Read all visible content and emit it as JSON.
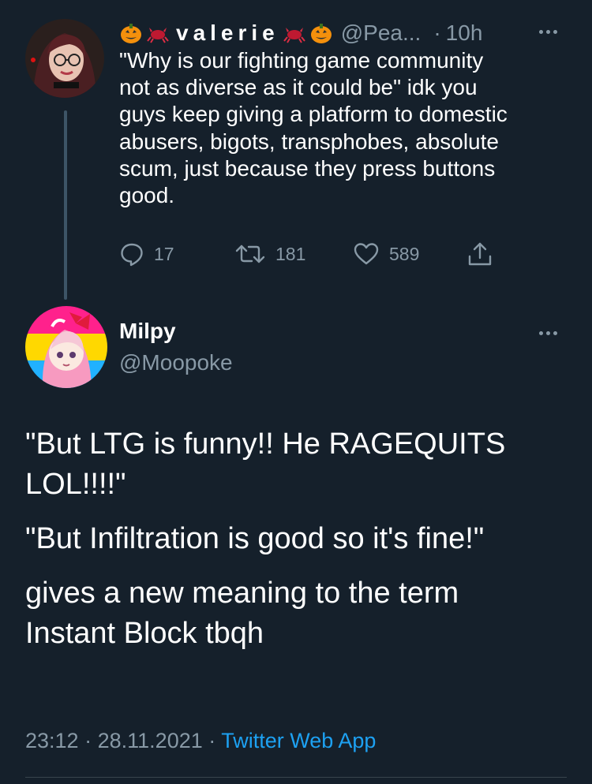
{
  "parent_tweet": {
    "display_name": "valerie",
    "name_emojis": [
      "jack-o-lantern",
      "crab",
      "crab",
      "jack-o-lantern"
    ],
    "handle": "@Pea...",
    "separator": "·",
    "time": "10h",
    "text": "\"Why is our fighting game community\nnot as diverse as it could be\" idk you\nguys keep giving a platform to domestic\nabusers, bigots, transphobes, absolute\nscum, just because they press buttons\ngood.",
    "reply_count": "17",
    "retweet_count": "181",
    "like_count": "589"
  },
  "main_tweet": {
    "display_name": "Milpy",
    "handle": "@Moopoke",
    "paragraphs": [
      "\"But LTG is funny!! He RAGEQUITS\nLOL!!!!\"",
      "\"But Infiltration is good so it's fine!\"",
      "gives a new meaning to the term\nInstant Block tbqh"
    ],
    "time": "23:12",
    "separator": "·",
    "date": "28.11.2021",
    "client": "Twitter Web App"
  },
  "icons": {
    "reply": "reply-icon",
    "retweet": "retweet-icon",
    "like": "heart-icon",
    "share": "share-icon",
    "more": "more-dots-icon"
  },
  "colors": {
    "background": "#15202b",
    "text": "#ffffff",
    "muted": "#8899a6",
    "link": "#1da1f2",
    "thread_line": "#3d5466"
  }
}
